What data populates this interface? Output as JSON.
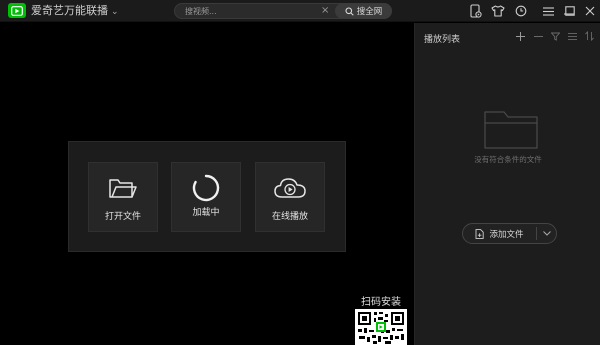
{
  "app": {
    "title": "爱奇艺万能联播",
    "brand_color": "#00be06"
  },
  "search": {
    "placeholder": "搜视频...",
    "clear_icon": "close-icon",
    "button_label": "搜全网",
    "button_icon": "search-icon"
  },
  "titlebar_icons": [
    "phone-video-icon",
    "tshirt-skin-icon",
    "history-clock-icon",
    "menu-icon",
    "minimize-icon",
    "maximize-icon",
    "close-icon"
  ],
  "player": {
    "tiles": [
      {
        "label": "打开文件",
        "icon": "folder-open-icon"
      },
      {
        "label": "加载中",
        "icon": "loading-spinner-icon"
      },
      {
        "label": "在线播放",
        "icon": "cloud-play-icon"
      }
    ],
    "qr_label": "扫码安装"
  },
  "playlist": {
    "title": "播放列表",
    "tools": [
      "add-icon",
      "remove-icon",
      "filter-icon",
      "list-icon",
      "sort-icon"
    ],
    "empty_text": "没有符合条件的文件",
    "add_button_label": "添加文件"
  }
}
